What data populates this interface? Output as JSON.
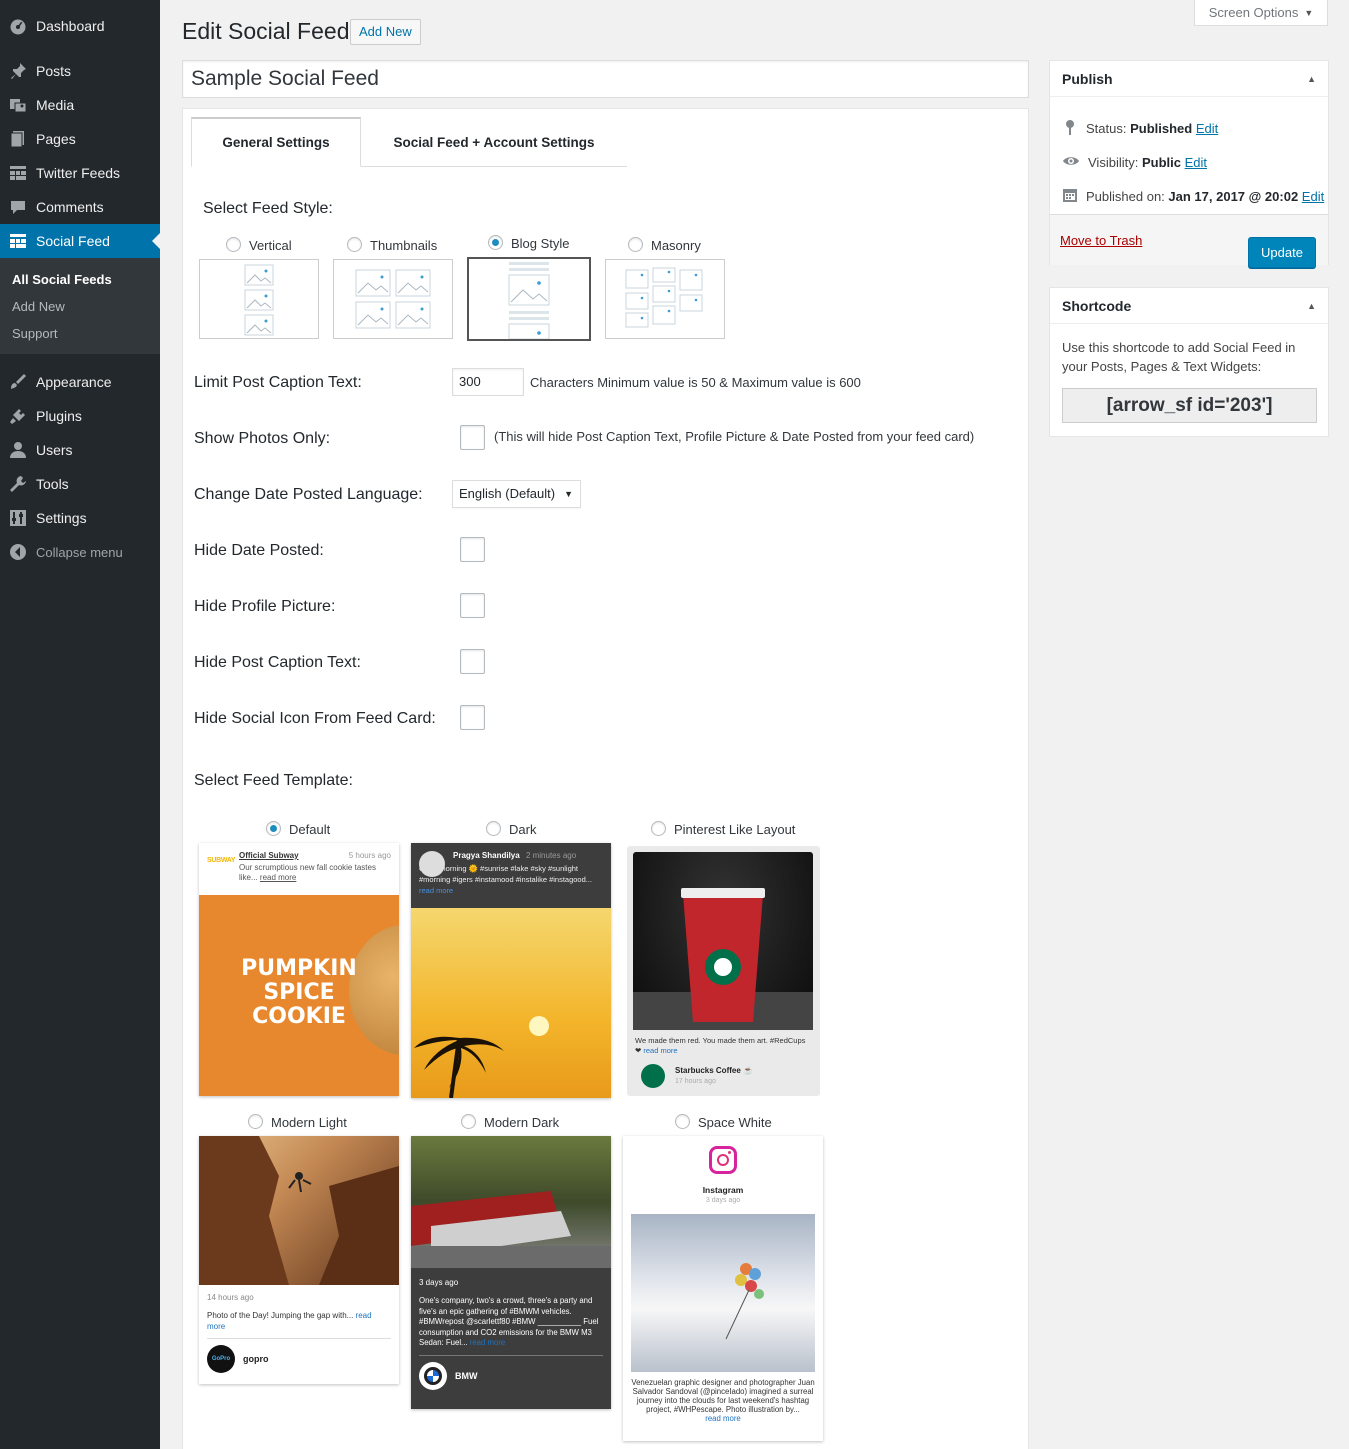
{
  "menu": {
    "dashboard": "Dashboard",
    "posts": "Posts",
    "media": "Media",
    "pages": "Pages",
    "twitter": "Twitter Feeds",
    "comments": "Comments",
    "social": "Social Feed",
    "sub_all": "All Social Feeds",
    "sub_add": "Add New",
    "sub_support": "Support",
    "appearance": "Appearance",
    "plugins": "Plugins",
    "users": "Users",
    "tools": "Tools",
    "settings": "Settings",
    "collapse": "Collapse menu"
  },
  "header": {
    "title": "Edit Social Feed",
    "add_new": "Add New",
    "screen_options": "Screen Options",
    "post_title": "Sample Social Feed"
  },
  "tabs": {
    "general": "General Settings",
    "account": "Social Feed + Account Settings"
  },
  "settings": {
    "feed_style_label": "Select Feed Style:",
    "styles": {
      "vertical": "Vertical",
      "thumbnails": "Thumbnails",
      "blog": "Blog Style",
      "masonry": "Masonry"
    },
    "selected_style": "Blog Style",
    "limit_label": "Limit Post Caption Text:",
    "limit_value": "300",
    "limit_note": "Characters Minimum value is 50 & Maximum value is 600",
    "photos_only_label": "Show Photos Only:",
    "photos_only_note": "(This will hide Post Caption Text, Profile Picture & Date Posted from your feed card)",
    "language_label": "Change Date Posted Language:",
    "language_value": "English (Default)",
    "hide_date_label": "Hide Date Posted:",
    "hide_profile_label": "Hide Profile Picture:",
    "hide_caption_label": "Hide Post Caption Text:",
    "hide_icon_label": "Hide Social Icon From Feed Card:",
    "template_label": "Select Feed Template:",
    "templates": {
      "default": "Default",
      "dark": "Dark",
      "pinterest": "Pinterest Like Layout",
      "modern_light": "Modern Light",
      "modern_dark": "Modern Dark",
      "space_white": "Space White"
    },
    "selected_template": "Default"
  },
  "previews": {
    "default": {
      "name": "Official Subway",
      "time": "5 hours ago",
      "text": "Our scrumptious new fall cookie tastes like...",
      "read": "read more",
      "brand": "SUBWAY",
      "headline_1": "PUMPKIN",
      "headline_2": "SPICE",
      "headline_3": "COOKIE"
    },
    "dark": {
      "name": "Pragya Shandilya",
      "time": "2 minutes ago",
      "text": "Good morning 🌞 #sunrise #lake #sky #sunlight #morning #igers #instamood #instalike #instagood...",
      "read": "read more"
    },
    "pinterest": {
      "text": "We made them red. You made them art. #RedCups ❤",
      "read": "read more",
      "name": "Starbucks Coffee ☕",
      "time": "17 hours ago"
    },
    "modern_light": {
      "time": "14 hours ago",
      "text": "Photo of the Day! Jumping the gap with...",
      "read": "read more",
      "name": "gopro",
      "logo": "GoPro"
    },
    "modern_dark": {
      "time": "3 days ago",
      "text": "One's company, two's a crowd, three's a party and five's an epic gathering of #BMWM vehicles. #BMWrepost @scarlettf80 #BMW __________ Fuel consumption and CO2 emissions for the BMW M3 Sedan: Fuel...",
      "read": "read more",
      "name": "BMW"
    },
    "space_white": {
      "name": "Instagram",
      "time": "3 days ago",
      "text": "Venezuelan graphic designer and photographer Juan Salvador Sandoval (@pinceIado) imagined a surreal journey into the clouds for last weekend's hashtag project, #WHPescape. Photo illustration by...",
      "read": "read more"
    }
  },
  "publish": {
    "title": "Publish",
    "status_label": "Status:",
    "status_value": "Published",
    "visibility_label": "Visibility:",
    "visibility_value": "Public",
    "published_label": "Published on:",
    "published_value": "Jan 17, 2017 @ 20:02",
    "edit": "Edit",
    "trash": "Move to Trash",
    "update": "Update"
  },
  "shortcode": {
    "title": "Shortcode",
    "desc": "Use this shortcode to add Social Feed in your Posts, Pages & Text Widgets:",
    "code": "[arrow_sf id='203']"
  },
  "colors": {
    "accent": "#0073aa",
    "sidebar": "#23282d",
    "update": "#0085ba"
  }
}
